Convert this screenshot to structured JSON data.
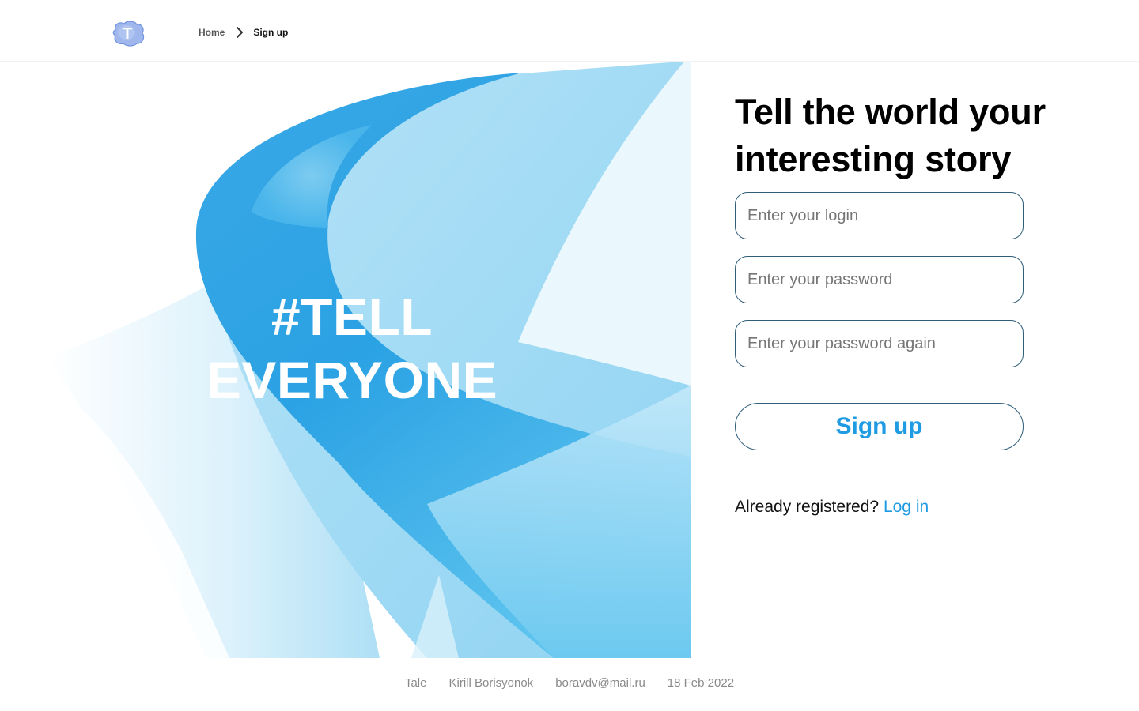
{
  "header": {
    "logo_letter": "T",
    "breadcrumb": {
      "home": "Home",
      "current": "Sign up"
    }
  },
  "hero": {
    "line1": "#TELL",
    "line2": "EVERYONE"
  },
  "form": {
    "title": "Tell the world your interesting story",
    "login_placeholder": "Enter your login",
    "password_placeholder": "Enter your password",
    "password_again_placeholder": "Enter your password again",
    "submit_label": "Sign up",
    "already_text": "Already registered?",
    "login_link": "Log in"
  },
  "footer": {
    "items": [
      "Tale",
      "Kirill Borisyonok",
      "boravdv@mail.ru",
      "18 Feb 2022"
    ]
  },
  "colors": {
    "accent": "#1e9be2",
    "border": "#2f5d7a",
    "hero_blue": "#2aa3e3",
    "hero_light": "#a8def5"
  }
}
